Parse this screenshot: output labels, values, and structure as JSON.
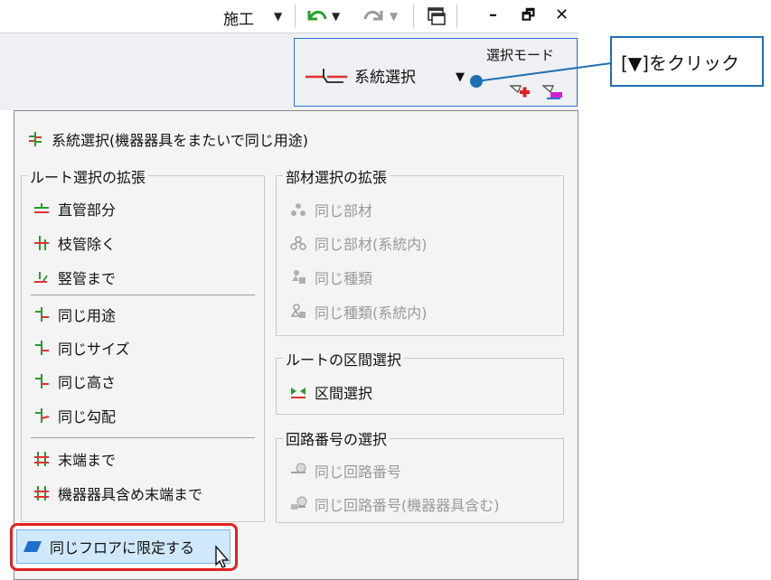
{
  "titlebar": {
    "tab_label": "施工",
    "minimize": "–",
    "restore": "🗗",
    "close": "✕",
    "icons": [
      "undo-icon",
      "redo-icon",
      "window-icon"
    ]
  },
  "ribbon": {
    "mode_title": "選択モード",
    "mode_label": "系統選択"
  },
  "callout": {
    "text": "[▼]をクリック"
  },
  "menu": {
    "top_item": "系統選択(機器器具をまたいで同じ用途)",
    "route_ext": {
      "title": "ルート選択の拡張",
      "items": [
        "直管部分",
        "枝管除く",
        "竪管まで",
        "同じ用途",
        "同じサイズ",
        "同じ高さ",
        "同じ勾配",
        "末端まで",
        "機器器具含め末端まで"
      ]
    },
    "member_ext": {
      "title": "部材選択の拡張",
      "items": [
        "同じ部材",
        "同じ部材(系統内)",
        "同じ種類",
        "同じ種類(系統内)"
      ]
    },
    "section": {
      "title": "ルートの区間選択",
      "items": [
        "区間選択"
      ]
    },
    "circuit": {
      "title": "回路番号の選択",
      "items": [
        "同じ回路番号",
        "同じ回路番号(機器器具含む)"
      ]
    },
    "floor_button": "同じフロアに限定する"
  },
  "colors": {
    "accent_blue": "#2f6fd8",
    "highlight_red": "#e02020",
    "callout_border": "#1f6fb6",
    "floor_btn_bg": "#cfe8fb"
  }
}
